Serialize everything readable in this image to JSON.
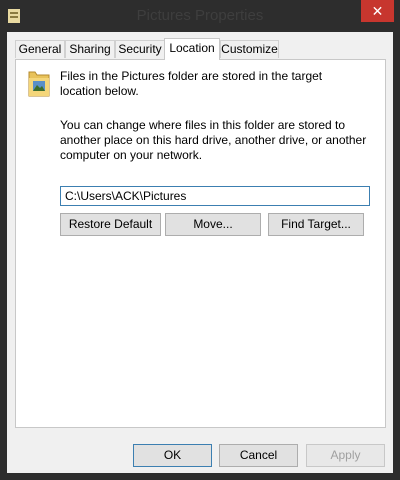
{
  "window": {
    "title": "Pictures Properties",
    "close_glyph": "✕"
  },
  "tabs": [
    {
      "label": "General"
    },
    {
      "label": "Sharing"
    },
    {
      "label": "Security"
    },
    {
      "label": "Location",
      "active": true
    },
    {
      "label": "Customize"
    }
  ],
  "location": {
    "description": "Files in the Pictures folder are stored in the target location below.",
    "instructions": "You can change where files in this folder are stored to another place on this hard drive, another drive, or another computer on your network.",
    "path_value": "C:\\Users\\ACK\\Pictures",
    "restore_default_label": "Restore Default",
    "move_label": "Move...",
    "find_target_label": "Find Target..."
  },
  "footer": {
    "ok_label": "OK",
    "cancel_label": "Cancel",
    "apply_label": "Apply"
  },
  "colors": {
    "titlebar": "#2d2d2d",
    "close_button": "#c7362e",
    "focus_border": "#3c7fb1"
  }
}
